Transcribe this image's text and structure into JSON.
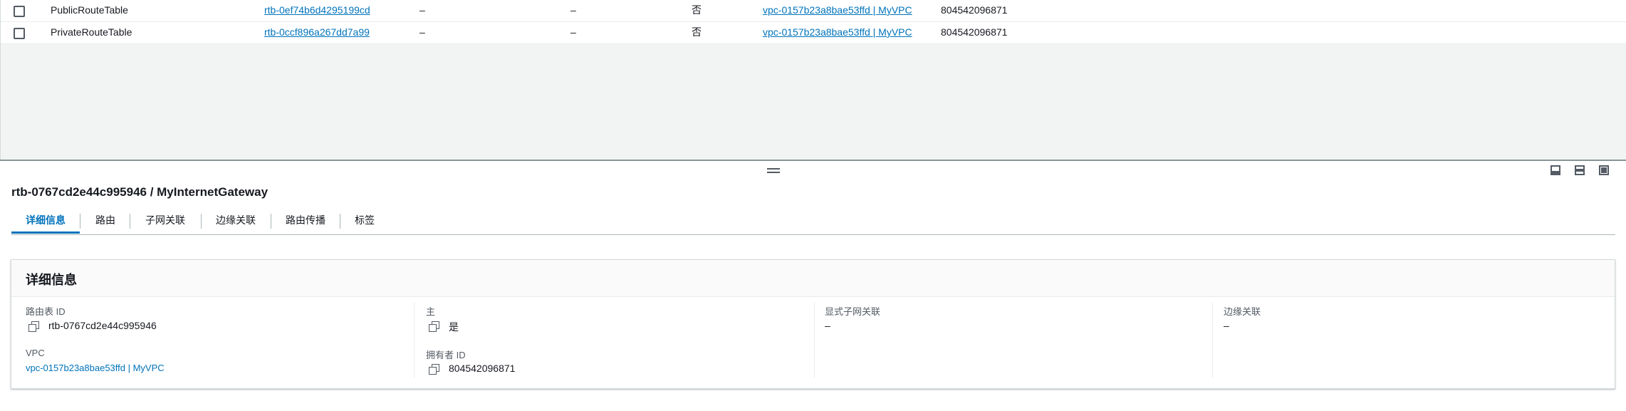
{
  "table": {
    "rows": [
      {
        "name": "PublicRouteTable",
        "id": "rtb-0ef74b6d4295199cd",
        "col3": "–",
        "col4": "–",
        "main": "否",
        "vpc": "vpc-0157b23a8bae53ffd | MyVPC",
        "owner": "804542096871"
      },
      {
        "name": "PrivateRouteTable",
        "id": "rtb-0ccf896a267dd7a99",
        "col3": "–",
        "col4": "–",
        "main": "否",
        "vpc": "vpc-0157b23a8bae53ffd | MyVPC",
        "owner": "804542096871"
      }
    ]
  },
  "panel": {
    "title": "rtb-0767cd2e44c995946 / MyInternetGateway",
    "tabs": [
      {
        "label": "详细信息",
        "active": true
      },
      {
        "label": "路由"
      },
      {
        "label": "子网关联"
      },
      {
        "label": "边缘关联"
      },
      {
        "label": "路由传播"
      },
      {
        "label": "标签"
      }
    ],
    "details": {
      "header": "详细信息",
      "route_table_id_label": "路由表 ID",
      "route_table_id": "rtb-0767cd2e44c995946",
      "vpc_label": "VPC",
      "vpc_value": "vpc-0157b23a8bae53ffd | MyVPC",
      "main_label": "主",
      "main_value": "是",
      "owner_label": "拥有者 ID",
      "owner_value": "804542096871",
      "explicit_subnet_label": "显式子网关联",
      "explicit_subnet_value": "–",
      "edge_label": "边缘关联",
      "edge_value": "–"
    }
  },
  "icons": [
    "checkbox",
    "drag-handle-icon",
    "view-bottom-icon",
    "view-side-icon",
    "view-full-icon",
    "copy-icon"
  ],
  "colors": {
    "link": "#0073bb",
    "active_tab": "#0073bb",
    "background": "#f2f3f3"
  }
}
